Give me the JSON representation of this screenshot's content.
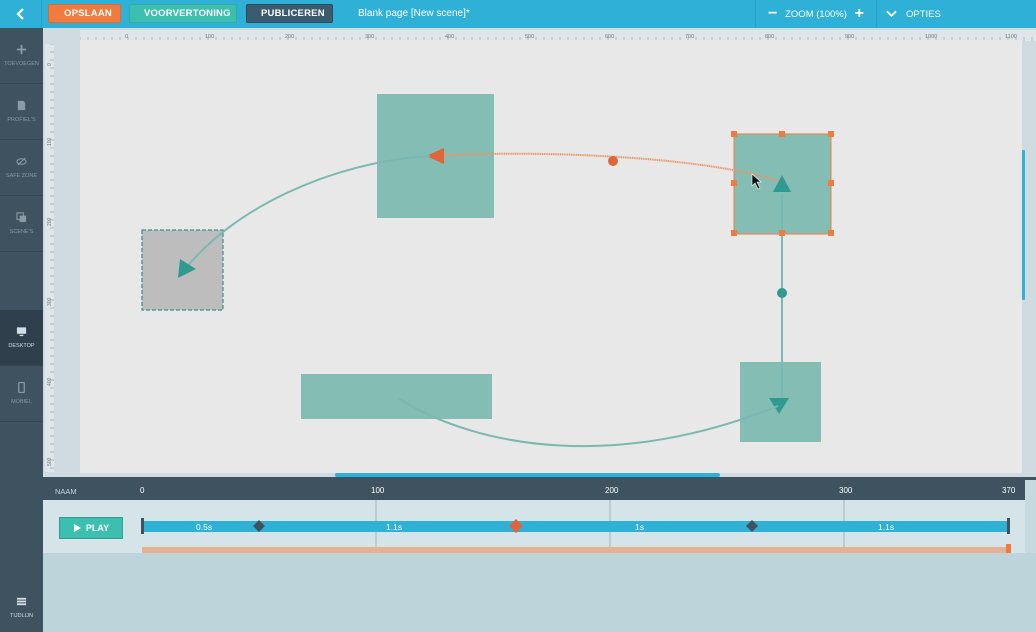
{
  "toolbar": {
    "save_label": "OPSLAAN",
    "preview_label": "VOORVERTONING",
    "publish_label": "PUBLICEREN",
    "doc_title": "Blank page [New scene]*",
    "zoom_label": "ZOOM (100%)",
    "zoom_out": "−",
    "zoom_in": "+",
    "options_label": "OPTIES"
  },
  "sidebar": {
    "items": [
      {
        "label": "TOEVOEGEN",
        "icon": "plus-icon"
      },
      {
        "label": "PROFIEL'S",
        "icon": "document-icon"
      },
      {
        "label": "SAFE ZONE",
        "icon": "eye-slash-icon"
      },
      {
        "label": "SCENE'S",
        "icon": "copy-icon"
      },
      {
        "label": "DESKTOP",
        "icon": "monitor-icon"
      },
      {
        "label": "MOBIEL",
        "icon": "phone-icon"
      }
    ],
    "bottom_label": "TIJDLIJN"
  },
  "ruler": {
    "top_ticks": [
      "0",
      "100",
      "200",
      "300",
      "400",
      "500",
      "600",
      "700",
      "800",
      "900",
      "1000",
      "1100"
    ],
    "left_ticks": [
      "0",
      "100",
      "200",
      "300",
      "400",
      "500"
    ]
  },
  "timeline": {
    "name_header": "NAAM",
    "play_label": "PLAY",
    "ticks": [
      "0",
      "100",
      "200",
      "300",
      "370"
    ],
    "segments": [
      "0.5s",
      "1.1s",
      "1s",
      "1.1s"
    ]
  },
  "colors": {
    "accent": "#2fb0d6",
    "teal": "#3cbfae",
    "orange": "#f07b3f",
    "dark": "#3e5260",
    "shape": "#84bdb3"
  }
}
